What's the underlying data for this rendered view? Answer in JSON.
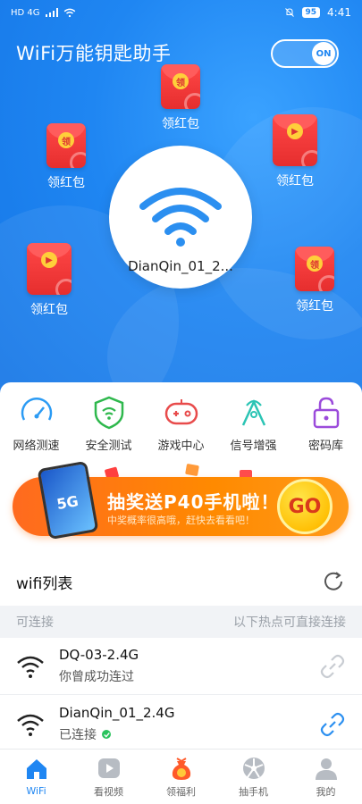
{
  "status_bar": {
    "left": "HD 4G",
    "battery": "95",
    "time": "4:41"
  },
  "header": {
    "title": "WiFi万能钥匙助手",
    "toggle_label": "ON"
  },
  "current_wifi": {
    "ssid": "DianQin_01_2..."
  },
  "red_packets": [
    {
      "label": "领红包",
      "seal": "领"
    },
    {
      "label": "领红包",
      "seal": "领"
    },
    {
      "label": "领红包",
      "seal": "▶"
    },
    {
      "label": "领红包",
      "seal": "▶"
    },
    {
      "label": "领红包",
      "seal": "领"
    }
  ],
  "tools": [
    {
      "label": "网络测速",
      "icon": "speedometer-icon",
      "color": "#2b9bf4"
    },
    {
      "label": "安全测试",
      "icon": "shield-wifi-icon",
      "color": "#2fb84d"
    },
    {
      "label": "游戏中心",
      "icon": "gamepad-icon",
      "color": "#e84b4b"
    },
    {
      "label": "信号增强",
      "icon": "signal-boost-icon",
      "color": "#2bc4b4"
    },
    {
      "label": "密码库",
      "icon": "lock-icon",
      "color": "#9b4bdb"
    }
  ],
  "banner": {
    "title": "抽奖送P40手机啦！",
    "subtitle": "中奖概率很高哦，赶快去看看吧！",
    "go": "GO",
    "phone_text": "5G"
  },
  "wifi_list": {
    "title": "wifi列表",
    "sub_left": "可连接",
    "sub_right": "以下热点可直接连接",
    "items": [
      {
        "name": "DQ-03-2.4G",
        "status": "你曾成功连过",
        "connected": false
      },
      {
        "name": "DianQin_01_2.4G",
        "status": "已连接",
        "connected": true
      }
    ]
  },
  "nav": [
    {
      "label": "WiFi",
      "icon": "home-icon",
      "active": true
    },
    {
      "label": "看视频",
      "icon": "video-icon",
      "active": false
    },
    {
      "label": "领福利",
      "icon": "money-bag-icon",
      "active": false
    },
    {
      "label": "抽手机",
      "icon": "lottery-wheel-icon",
      "active": false
    },
    {
      "label": "我的",
      "icon": "profile-icon",
      "active": false
    }
  ],
  "colors": {
    "primary": "#1f86f2",
    "accent_orange": "#ff8a00",
    "connected_green": "#2ac35d"
  }
}
